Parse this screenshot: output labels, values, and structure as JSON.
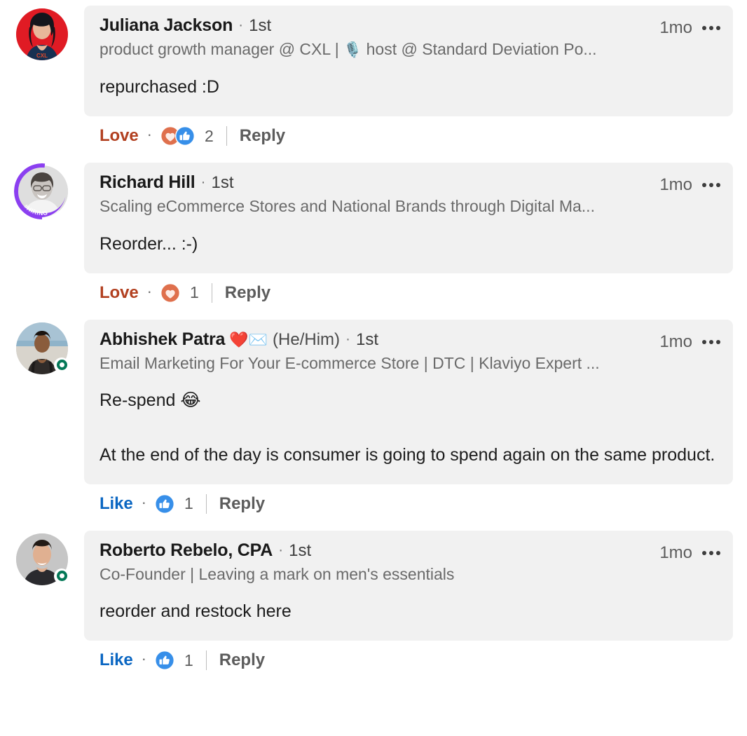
{
  "colors": {
    "love": "#b24020",
    "like": "#0a66c2",
    "reply": "#5c5c5c",
    "bubble_bg": "#f1f1f1",
    "page_bg": "#ffffff",
    "headline": "#6a6a6a",
    "open_badge_green": "#047857",
    "hiring_purple": "#7c3aed"
  },
  "comments": [
    {
      "author": "Juliana Jackson",
      "name_emoji": "",
      "pronouns": "",
      "degree": "1st",
      "separator": "·",
      "headline_prefix": "product growth manager @ CXL | ",
      "headline_emoji": "🎙️",
      "headline_suffix": " host @ Standard Deviation Po...",
      "timestamp": "1mo",
      "text": "repurchased :D",
      "action_label": "Love",
      "action_type": "love",
      "reactions": [
        "love",
        "like"
      ],
      "reaction_count": "2",
      "reply_label": "Reply",
      "avatar": "juliana-jackson-avatar",
      "avatar_frame": "",
      "avatar_badge": ""
    },
    {
      "author": "Richard Hill",
      "name_emoji": "",
      "pronouns": "",
      "degree": "1st",
      "separator": "·",
      "headline_prefix": "Scaling eCommerce Stores and National Brands through Digital Ma...",
      "headline_emoji": "",
      "headline_suffix": "",
      "timestamp": "1mo",
      "text": "Reorder... :-)",
      "action_label": "Love",
      "action_type": "love",
      "reactions": [
        "love"
      ],
      "reaction_count": "1",
      "reply_label": "Reply",
      "avatar": "richard-hill-avatar",
      "avatar_frame": "#HIRING",
      "avatar_badge": ""
    },
    {
      "author": "Abhishek Patra",
      "name_emoji": "❤️✉️",
      "pronouns": "(He/Him)",
      "degree": "1st",
      "separator": "·",
      "headline_prefix": "Email Marketing For Your E-commerce Store | DTC | Klaviyo Expert ...",
      "headline_emoji": "",
      "headline_suffix": "",
      "timestamp": "1mo",
      "text": "Re-spend 😂\n\nAt the end of the day is consumer is going to spend again on the same product.",
      "action_label": "Like",
      "action_type": "like",
      "reactions": [
        "like"
      ],
      "reaction_count": "1",
      "reply_label": "Reply",
      "avatar": "abhishek-patra-avatar",
      "avatar_frame": "",
      "avatar_badge": "open-to-work"
    },
    {
      "author": "Roberto Rebelo, CPA",
      "name_emoji": "",
      "pronouns": "",
      "degree": "1st",
      "separator": "·",
      "headline_prefix": "Co-Founder | Leaving a mark on men's essentials",
      "headline_emoji": "",
      "headline_suffix": "",
      "timestamp": "1mo",
      "text": "reorder and restock here",
      "action_label": "Like",
      "action_type": "like",
      "reactions": [
        "like"
      ],
      "reaction_count": "1",
      "reply_label": "Reply",
      "avatar": "roberto-rebelo-avatar",
      "avatar_frame": "",
      "avatar_badge": "open-to-work"
    }
  ]
}
